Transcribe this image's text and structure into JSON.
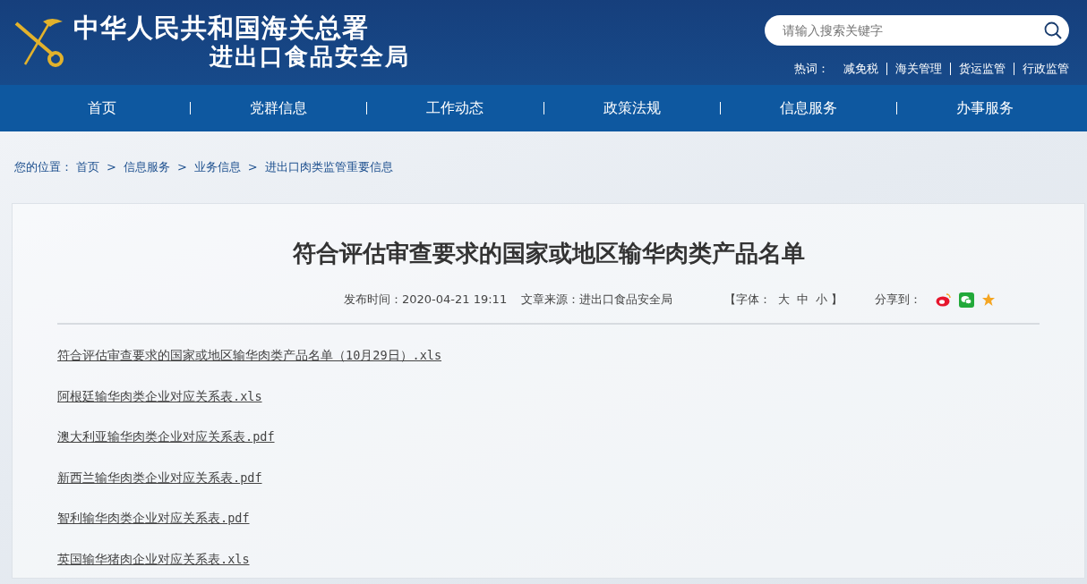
{
  "header": {
    "title_line1": "中华人民共和国海关总署",
    "title_line2": "进出口食品安全局",
    "search": {
      "placeholder": "请输入搜索关键字"
    },
    "hot_words": {
      "label": "热词：",
      "items": [
        "减免税",
        "海关管理",
        "货运监管",
        "行政监管"
      ]
    }
  },
  "nav": [
    {
      "label": "首页"
    },
    {
      "label": "党群信息"
    },
    {
      "label": "工作动态"
    },
    {
      "label": "政策法规"
    },
    {
      "label": "信息服务"
    },
    {
      "label": "办事服务"
    }
  ],
  "breadcrumb": {
    "label": "您的位置：",
    "separator": ">",
    "items": [
      "首页",
      "信息服务",
      "业务信息",
      "进出口肉类监管重要信息"
    ]
  },
  "article": {
    "title": "符合评估审查要求的国家或地区输华肉类产品名单",
    "publish_time": "发布时间：2020-04-21 19:11",
    "source": "文章来源：进出口食品安全局",
    "font_size": {
      "open": "【字体：",
      "options": [
        "大",
        "中",
        "小"
      ],
      "close": "】"
    },
    "share_label": "分享到：",
    "attachments": [
      "符合评估审查要求的国家或地区输华肉类产品名单（10月29日）.xls",
      "阿根廷输华肉类企业对应关系表.xls",
      "澳大利亚输华肉类企业对应关系表.pdf",
      "新西兰输华肉类企业对应关系表.pdf",
      "智利输华肉类企业对应关系表.pdf",
      "英国输华猪肉企业对应关系表.xls"
    ]
  }
}
